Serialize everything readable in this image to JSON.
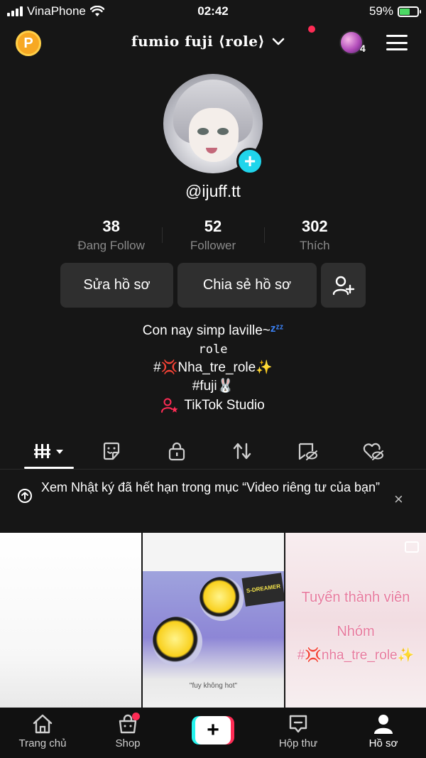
{
  "status_bar": {
    "carrier": "VinaPhone",
    "time": "02:42",
    "battery": "59%",
    "battery_level": 0.59
  },
  "header": {
    "points_badge": "P",
    "title": "fumio fuji ⟨role⟩",
    "story_count": "4"
  },
  "profile": {
    "username": "@ijuff.tt"
  },
  "stats": [
    {
      "value": "38",
      "label": "Đang Follow"
    },
    {
      "value": "52",
      "label": "Follower"
    },
    {
      "value": "302",
      "label": "Thích"
    }
  ],
  "actions": {
    "edit": "Sửa hồ sơ",
    "share": "Chia sẻ hồ sơ"
  },
  "bio": {
    "line1": "Con nay simp laville~",
    "line1_emoji": "zᶻᶻ",
    "line2": "role",
    "line3": "#💢Nha_tre_role✨",
    "line4": "#fuji🐰"
  },
  "studio_link": "TikTok Studio",
  "tabs": [
    "videos-grid",
    "reposts-sticker",
    "private-lock",
    "reposts",
    "hidden-liked",
    "liked-hidden"
  ],
  "notice": {
    "text": "Xem Nhật ký đã hết hạn trong mục “Video riêng tư của bạn”",
    "close": "×"
  },
  "videos": [
    {
      "type": "blank"
    },
    {
      "type": "image",
      "caption": "\"fuy không hot\"",
      "sticker": "S-DREAMER"
    },
    {
      "type": "text",
      "lines": [
        "Tuyển thành viên",
        "Nhóm",
        "#💢nha_tre_role✨"
      ]
    }
  ],
  "bottom_nav": [
    {
      "label": "Trang chủ"
    },
    {
      "label": "Shop"
    },
    {
      "label": ""
    },
    {
      "label": "Hộp thư"
    },
    {
      "label": "Hồ sơ"
    }
  ],
  "colors": {
    "background": "#161616",
    "accent_cyan": "#20d5ec",
    "accent_red": "#fe2c55",
    "badge_gold": "#f7a823"
  }
}
